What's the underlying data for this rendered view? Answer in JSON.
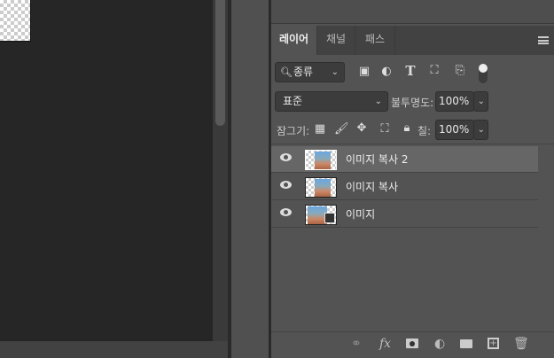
{
  "tabs": [
    "레이어",
    "채널",
    "패스"
  ],
  "filter": {
    "label": "종류"
  },
  "blend": {
    "mode": "표준",
    "opacity_label": "불투명도:",
    "opacity": "100%"
  },
  "lock": {
    "label": "잠그기:",
    "fill_label": "칠:",
    "fill": "100%"
  },
  "layers": [
    {
      "name": "이미지 복사 2",
      "selected": true,
      "visible": true
    },
    {
      "name": "이미지 복사",
      "selected": false,
      "visible": true
    },
    {
      "name": "이미지",
      "selected": false,
      "visible": true,
      "smart_object": true
    }
  ],
  "bottom_icons": [
    "link-icon",
    "fx-icon",
    "mask-icon",
    "adjustment-icon",
    "folder-icon",
    "new-layer-icon",
    "trash-icon"
  ],
  "fx_label": "fx"
}
